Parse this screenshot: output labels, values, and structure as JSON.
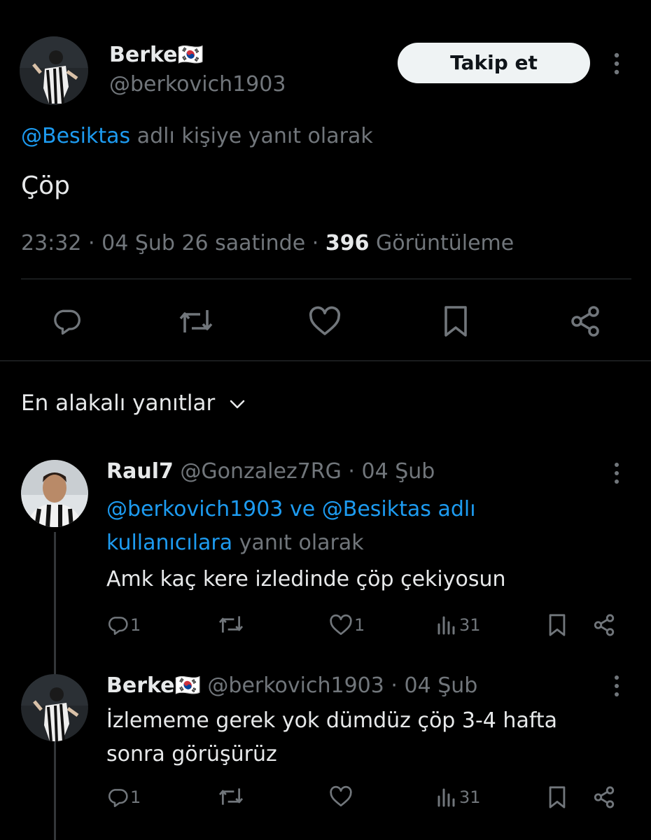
{
  "main_tweet": {
    "author_name": "Berke",
    "author_flag": "🇰🇷",
    "author_handle": "@berkovich1903",
    "follow_label": "Takip et",
    "reply_to_mention": "@Besiktas",
    "reply_to_suffix": "adlı kişiye yanıt olarak",
    "text": "Çöp",
    "time": "23:32",
    "sep": "·",
    "date": "04 Şub 26 saatinde",
    "views_count": "396",
    "views_label": "Görüntüleme"
  },
  "replies_sort_label": "En alakalı yanıtlar",
  "replies": [
    {
      "author_name": "Raul7",
      "author_handle": "@Gonzalez7RG",
      "sep": "·",
      "date": "04 Şub",
      "reply_to_line1_mention1": "@berkovich1903",
      "reply_to_line1_ve": "ve",
      "reply_to_line1_mention2": "@Besiktas adlı",
      "reply_to_line2_link": "kullanıcılara",
      "reply_to_line2_suffix": "yanıt olarak",
      "text": "Amk kaç kere izledinde çöp çekiyosun",
      "reply_count": "1",
      "like_count": "1",
      "view_count": "31"
    },
    {
      "author_name": "Berke",
      "author_flag": "🇰🇷",
      "author_handle": "@berkovich1903",
      "sep": "·",
      "date": "04 Şub",
      "text_line1": "İzlememe gerek yok dümdüz çöp 3-4 hafta",
      "text_line2": "sonra görüşürüz",
      "reply_count": "1",
      "view_count": "31"
    }
  ],
  "colors": {
    "background": "#000000",
    "text": "#e7e9ea",
    "muted": "#71767b",
    "link": "#1d9bf0",
    "divider": "#2f3336"
  }
}
